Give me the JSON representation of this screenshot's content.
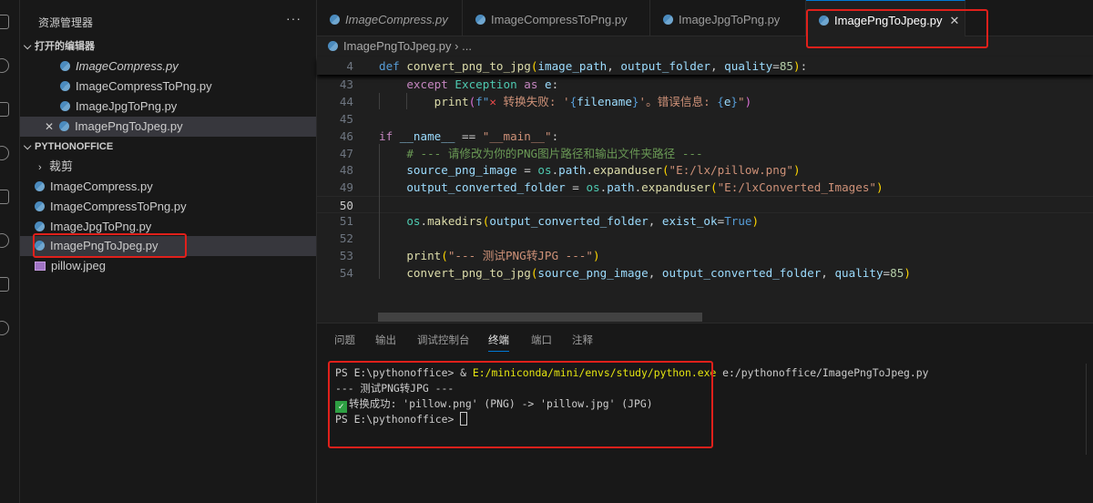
{
  "activity_bar": {
    "icons": [
      "explorer-icon",
      "search-icon",
      "source-control-icon",
      "run-debug-icon",
      "extensions-icon",
      "testing-icon",
      "remote-icon",
      "references-icon"
    ]
  },
  "sidebar": {
    "title": "资源管理器",
    "more": "···",
    "open_editors": {
      "label": "打开的编辑器",
      "items": [
        {
          "label": "ImageCompress.py",
          "italic": true
        },
        {
          "label": "ImageCompressToPng.py"
        },
        {
          "label": "ImageJpgToPng.py"
        },
        {
          "label": "ImagePngToJpeg.py",
          "selected": true,
          "close": "✕"
        }
      ]
    },
    "workspace": {
      "label": "PYTHONOFFICE",
      "folder": "裁剪",
      "files": [
        {
          "label": "ImageCompress.py",
          "icon": "python"
        },
        {
          "label": "ImageCompressToPng.py",
          "icon": "python"
        },
        {
          "label": "ImageJpgToPng.py",
          "icon": "python"
        },
        {
          "label": "ImagePngToJpeg.py",
          "icon": "python",
          "selected": true
        },
        {
          "label": "pillow.jpeg",
          "icon": "image"
        }
      ]
    }
  },
  "tabs": [
    {
      "label": "ImageCompress.py",
      "italic": true
    },
    {
      "label": "ImageCompressToPng.py"
    },
    {
      "label": "ImageJpgToPng.py"
    },
    {
      "label": "ImagePngToJpeg.py",
      "active": true,
      "close": "✕"
    }
  ],
  "breadcrumb": {
    "file": "ImagePngToJpeg.py",
    "sep": "›",
    "rest": "..."
  },
  "editor": {
    "lines": [
      {
        "n": "4",
        "sticky": true,
        "t": [
          [
            "def ",
            "kw"
          ],
          [
            "convert_png_to_jpg",
            "fn"
          ],
          [
            "(",
            "br"
          ],
          [
            "image_path",
            "pm"
          ],
          [
            ", ",
            "pl"
          ],
          [
            "output_folder",
            "pm"
          ],
          [
            ", ",
            "pl"
          ],
          [
            "quality",
            "pm"
          ],
          [
            "=",
            "pl"
          ],
          [
            "85",
            "nm"
          ],
          [
            ")",
            "br"
          ],
          [
            ":",
            "pl"
          ]
        ]
      },
      {
        "n": "43",
        "t": [
          [
            "    except ",
            "ctl"
          ],
          [
            "Exception",
            "cls"
          ],
          [
            " as ",
            "ctl"
          ],
          [
            "e",
            "pm"
          ],
          [
            ":",
            "pl"
          ]
        ]
      },
      {
        "n": "44",
        "t": [
          [
            "        print",
            "fn"
          ],
          [
            "(",
            "br2"
          ],
          [
            "f\"",
            "kw"
          ],
          [
            "✕",
            "x"
          ],
          [
            " 转换失败: '",
            "st"
          ],
          [
            "{",
            "kw"
          ],
          [
            "filename",
            "pm"
          ],
          [
            "}",
            "kw"
          ],
          [
            "'。错误信息: ",
            "st"
          ],
          [
            "{",
            "kw"
          ],
          [
            "e",
            "pm"
          ],
          [
            "}",
            "kw"
          ],
          [
            "\"",
            "st"
          ],
          [
            ")",
            "br2"
          ]
        ]
      },
      {
        "n": "45",
        "t": []
      },
      {
        "n": "46",
        "t": [
          [
            "if ",
            "ctl"
          ],
          [
            "__name__",
            "pm"
          ],
          [
            " == ",
            "pl"
          ],
          [
            "\"__main__\"",
            "st"
          ],
          [
            ":",
            "pl"
          ]
        ]
      },
      {
        "n": "47",
        "t": [
          [
            "    # --- 请修改为你的PNG图片路径和输出文件夹路径 ---",
            "cm"
          ]
        ]
      },
      {
        "n": "48",
        "t": [
          [
            "    source_png_image",
            "pm"
          ],
          [
            " = ",
            "pl"
          ],
          [
            "os",
            "cls"
          ],
          [
            ".",
            "pl"
          ],
          [
            "path",
            "pm"
          ],
          [
            ".",
            "pl"
          ],
          [
            "expanduser",
            "fn"
          ],
          [
            "(",
            "br"
          ],
          [
            "\"E:/lx/pillow.png\"",
            "st"
          ],
          [
            ")",
            "br"
          ]
        ]
      },
      {
        "n": "49",
        "t": [
          [
            "    output_converted_folder",
            "pm"
          ],
          [
            " = ",
            "pl"
          ],
          [
            "os",
            "cls"
          ],
          [
            ".",
            "pl"
          ],
          [
            "path",
            "pm"
          ],
          [
            ".",
            "pl"
          ],
          [
            "expanduser",
            "fn"
          ],
          [
            "(",
            "br"
          ],
          [
            "\"E:/lxConverted_Images\"",
            "st"
          ],
          [
            ")",
            "br"
          ]
        ]
      },
      {
        "n": "50",
        "current": true,
        "t": []
      },
      {
        "n": "51",
        "t": [
          [
            "    os",
            "cls"
          ],
          [
            ".",
            "pl"
          ],
          [
            "makedirs",
            "fn"
          ],
          [
            "(",
            "br"
          ],
          [
            "output_converted_folder",
            "pm"
          ],
          [
            ", ",
            "pl"
          ],
          [
            "exist_ok",
            "pm"
          ],
          [
            "=",
            "pl"
          ],
          [
            "True",
            "kw"
          ],
          [
            ")",
            "br"
          ]
        ]
      },
      {
        "n": "52",
        "t": []
      },
      {
        "n": "53",
        "t": [
          [
            "    print",
            "fn"
          ],
          [
            "(",
            "br"
          ],
          [
            "\"--- 测试PNG转JPG ---\"",
            "st"
          ],
          [
            ")",
            "br"
          ]
        ]
      },
      {
        "n": "54",
        "t": [
          [
            "    convert_png_to_jpg",
            "fn"
          ],
          [
            "(",
            "br"
          ],
          [
            "source_png_image",
            "pm"
          ],
          [
            ", ",
            "pl"
          ],
          [
            "output_converted_folder",
            "pm"
          ],
          [
            ", ",
            "pl"
          ],
          [
            "quality",
            "pm"
          ],
          [
            "=",
            "pl"
          ],
          [
            "85",
            "nm"
          ],
          [
            ")",
            "br"
          ]
        ]
      }
    ]
  },
  "panel": {
    "tabs": [
      "问题",
      "输出",
      "调试控制台",
      "终端",
      "端口",
      "注释"
    ],
    "active_tab": "终端",
    "terminal": {
      "cmd_prompt": "PS E:\\pythonoffice> & ",
      "cmd_exe": "E:/miniconda/mini/envs/study/python.exe",
      "cmd_arg": " e:/pythonoffice/ImagePngToJpeg.py",
      "line2": "--- 测试PNG转JPG ---",
      "check": "✓",
      "line3": "转换成功: 'pillow.png' (PNG) -> 'pillow.jpg' (JPG)",
      "prompt": "PS E:\\pythonoffice> "
    }
  }
}
